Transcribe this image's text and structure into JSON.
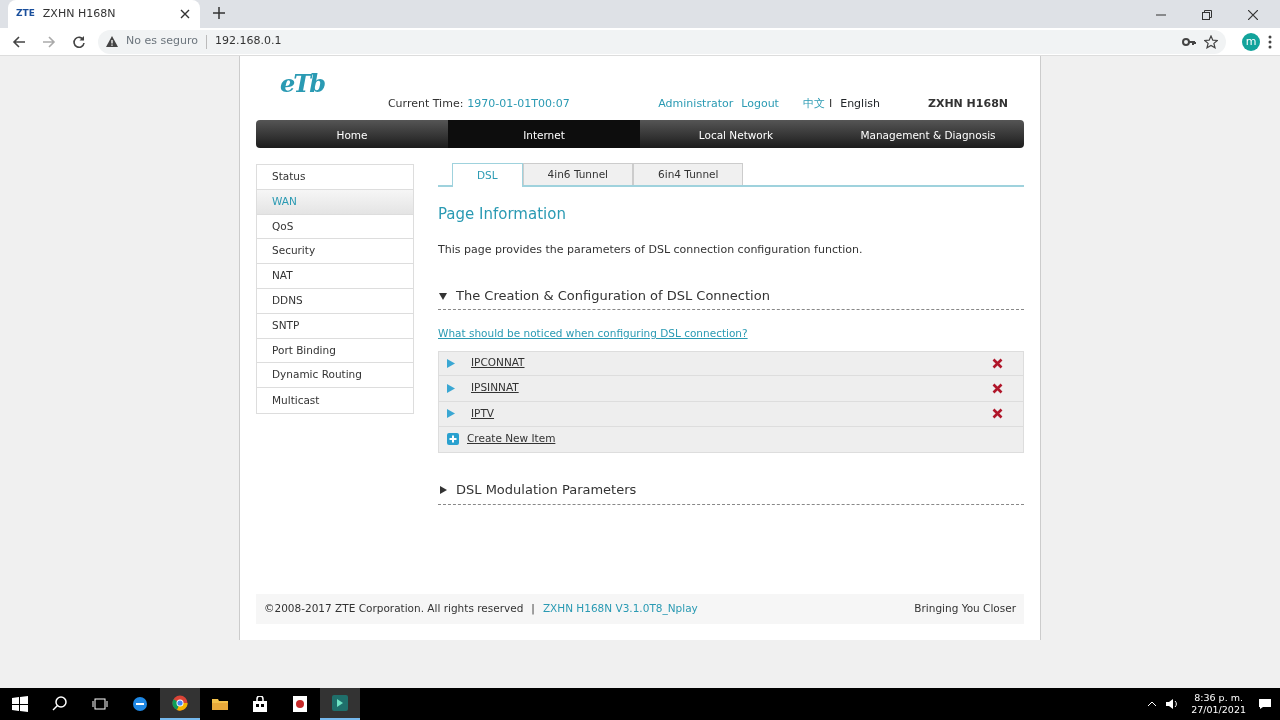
{
  "browser": {
    "tab": {
      "icon_text": "ZTE",
      "title": "ZXHN H168N"
    },
    "security": "No es seguro",
    "url": "192.168.0.1",
    "avatar": "m"
  },
  "header": {
    "logo": "eTb",
    "time_label": "Current Time:",
    "time": "1970-01-01T00:07",
    "user": "Administrator",
    "logout": "Logout",
    "separator": "I",
    "model": "ZXHN H168N",
    "languages": [
      {
        "label": "中文",
        "selected": false
      },
      {
        "label": "English",
        "selected": true
      }
    ]
  },
  "nav": [
    {
      "label": "Home",
      "selected": false
    },
    {
      "label": "Internet",
      "selected": true
    },
    {
      "label": "Local Network",
      "selected": false
    },
    {
      "label": "Management & Diagnosis",
      "selected": false
    }
  ],
  "sidebar": {
    "items": [
      {
        "label": "Status",
        "selected": false
      },
      {
        "label": "WAN",
        "selected": true
      },
      {
        "label": "QoS",
        "selected": false
      },
      {
        "label": "Security",
        "selected": false
      },
      {
        "label": "NAT",
        "selected": false
      },
      {
        "label": "DDNS",
        "selected": false
      },
      {
        "label": "SNTP",
        "selected": false
      },
      {
        "label": "Port Binding",
        "selected": false
      },
      {
        "label": "Dynamic Routing",
        "selected": false
      },
      {
        "label": "Multicast",
        "selected": false
      }
    ]
  },
  "tabs": [
    {
      "label": "DSL",
      "selected": true
    },
    {
      "label": "4in6 Tunnel",
      "selected": false
    },
    {
      "label": "6in4 Tunnel",
      "selected": false
    }
  ],
  "page_title": "Page Information",
  "description": "This page provides the parameters of DSL connection configuration function.",
  "sections": [
    {
      "title": "The Creation & Configuration of DSL Connection",
      "expanded": true,
      "help_link": "What should be noticed when configuring DSL connection?",
      "connections": [
        {
          "name": "IPCONNAT"
        },
        {
          "name": "IPSINNAT"
        },
        {
          "name": "IPTV"
        }
      ],
      "create_label": "Create New Item"
    },
    {
      "title": "DSL Modulation Parameters",
      "expanded": false
    }
  ],
  "footer": {
    "copyright": "©2008-2017 ZTE Corporation. All rights reserved",
    "separator": "|",
    "version": "ZXHN H168N V3.1.0T8_Nplay",
    "slogan": "Bringing You Closer"
  },
  "taskbar": {
    "time": "8:36 p. m.",
    "date": "27/01/2021"
  }
}
